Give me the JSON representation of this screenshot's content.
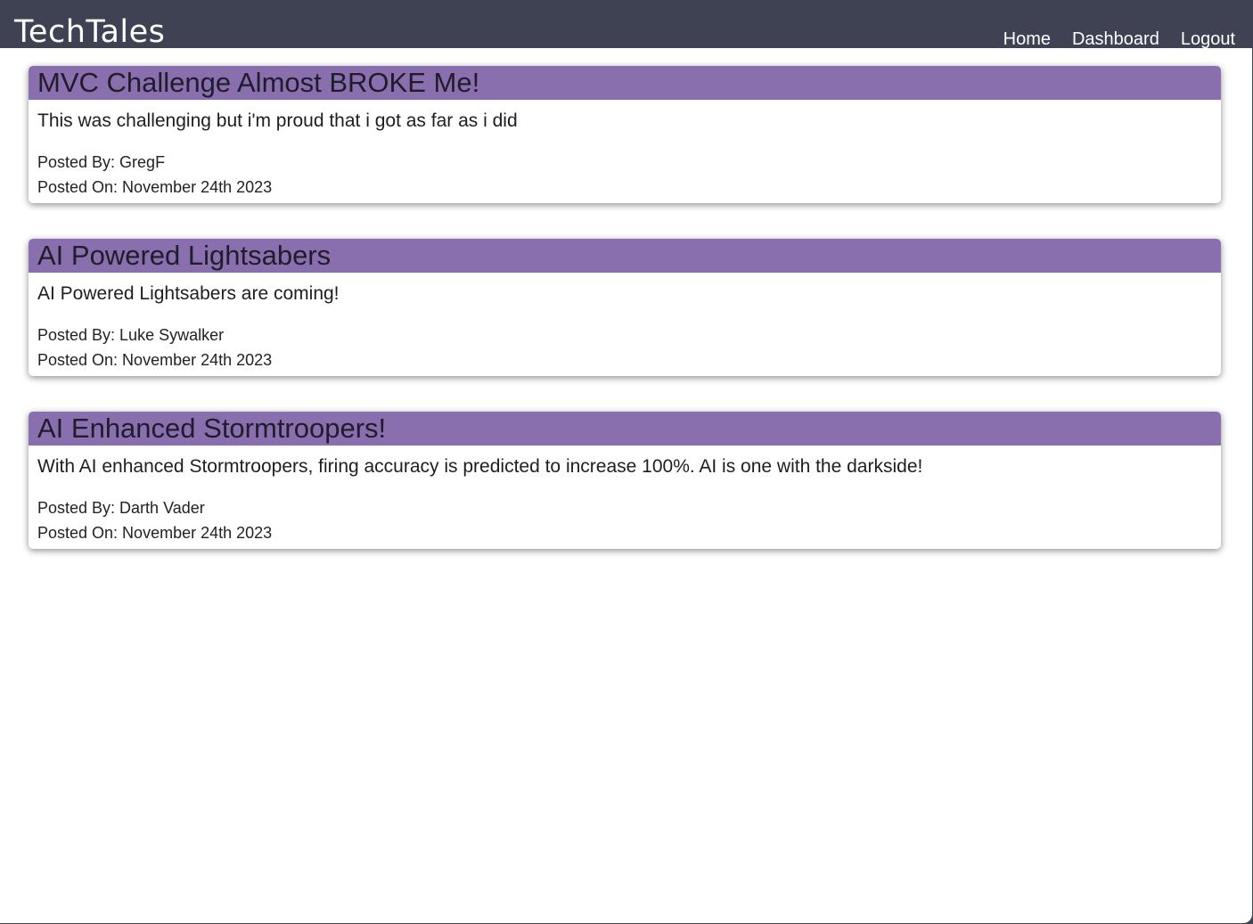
{
  "header": {
    "brand": "TechTales",
    "nav": {
      "home": "Home",
      "dashboard": "Dashboard",
      "logout": "Logout"
    }
  },
  "posts": [
    {
      "title": "MVC Challenge Almost BROKE Me!",
      "content": "This was challenging but i'm proud that i got as far as i did",
      "author": "Posted By: GregF",
      "date": "Posted On: November 24th 2023"
    },
    {
      "title": "AI Powered Lightsabers",
      "content": "AI Powered Lightsabers are coming!",
      "author": "Posted By: Luke Sywalker",
      "date": "Posted On: November 24th 2023"
    },
    {
      "title": "AI Enhanced Stormtroopers!",
      "content": "With AI enhanced Stormtroopers, firing accuracy is predicted to increase 100%. AI is one with the darkside!",
      "author": "Posted By: Darth Vader",
      "date": "Posted On: November 24th 2023"
    }
  ],
  "colors": {
    "header_bg": "#3f4252",
    "card_title_bg": "#896fae",
    "page_bg": "#ffffff"
  }
}
